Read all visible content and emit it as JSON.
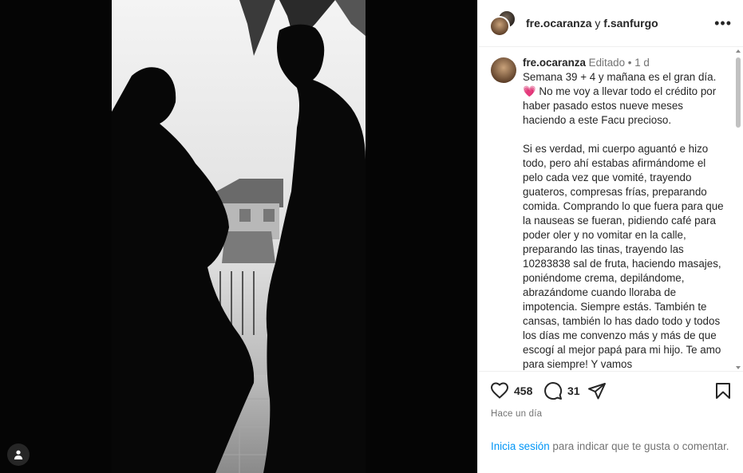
{
  "header": {
    "user1": "fre.ocaranza",
    "joiner": "y",
    "user2": "f.sanfurgo",
    "more": "•••"
  },
  "caption": {
    "username": "fre.ocaranza",
    "edited": "Editado",
    "dot": "•",
    "age": "1 d",
    "body": "Semana 39 + 4 y mañana es el gran día.\n💗 No me voy a llevar todo el crédito por haber pasado estos nueve meses haciendo a este Facu precioso.\n\nSi es verdad, mi cuerpo aguantó e hizo todo, pero ahí estabas afirmándome el pelo cada vez que vomité, trayendo guateros, compresas frías, preparando comida. Comprando lo que fuera para que la nauseas se fueran, pidiendo café para poder oler y no vomitar en la calle, preparando las tinas, trayendo las 10283838 sal de fruta, haciendo masajes, poniéndome crema, depilándome,  abrazándome cuando lloraba de impotencia. Siempre estás. También te cansas, también lo has dado todo y todos los días me convenzo más y más de que escogí al mejor papá para mi hijo. Te amo para siempre! Y vamos"
  },
  "actions": {
    "likes": "458",
    "comments": "31"
  },
  "time": "Hace un día",
  "login": {
    "link": "Inicia sesión",
    "rest": " para indicar que te gusta o comentar."
  },
  "icons": {
    "like": "heart-icon",
    "comment": "comment-icon",
    "share": "share-icon",
    "save": "bookmark-icon",
    "tag": "user-tag-icon",
    "more": "more-options-icon"
  }
}
